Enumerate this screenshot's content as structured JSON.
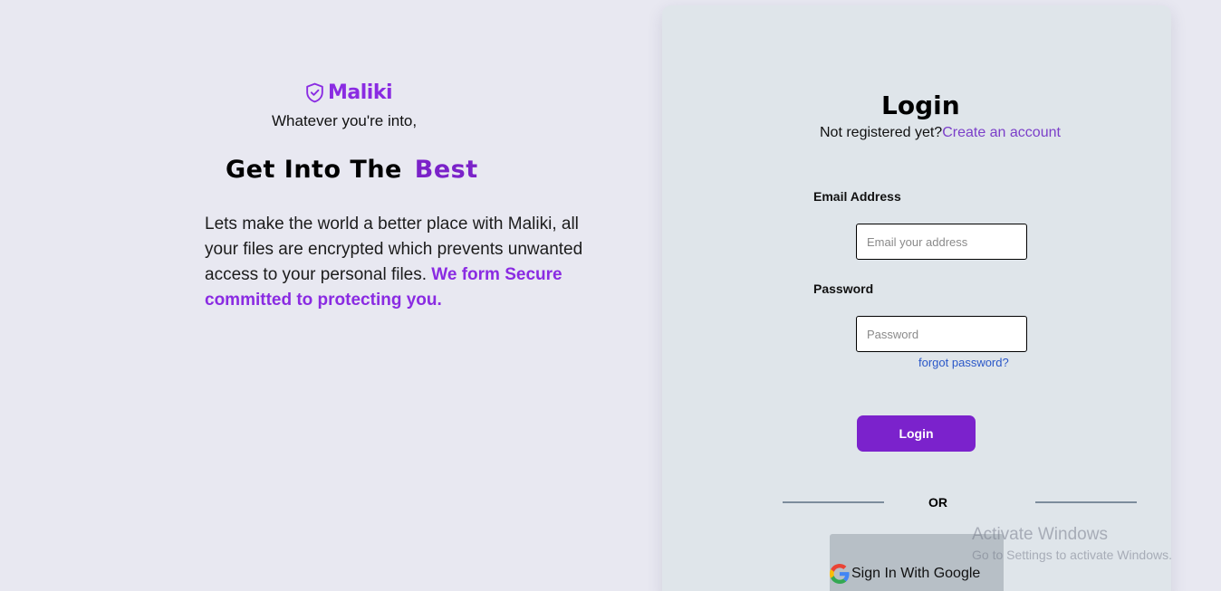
{
  "brand": {
    "name": "Maliki",
    "icon": "shield-check-icon",
    "color": "#8a2be2"
  },
  "hero": {
    "tagline": "Whatever you're into,",
    "headline": "Get Into The",
    "headline_accent": "Best",
    "body": "Lets make the world a better place with Maliki, all your files are encrypted which prevents unwanted access to your personal files.",
    "body_highlight": "We form Secure committed to protecting you."
  },
  "login": {
    "title": "Login",
    "register_prompt": "Not registered yet?",
    "register_link": "Create an account",
    "email_label": "Email Address",
    "email_placeholder": "Email your address",
    "email_value": "",
    "password_label": "Password",
    "password_placeholder": "Password",
    "password_value": "",
    "forgot_link": "forgot password?",
    "submit_label": "Login",
    "divider_text": "OR",
    "google_label": "Sign In With Google",
    "google_icon": "google-g-icon",
    "accent_color": "#7b22cc"
  },
  "watermark": {
    "title": "Activate Windows",
    "subtitle": "Go to Settings to activate Windows."
  }
}
